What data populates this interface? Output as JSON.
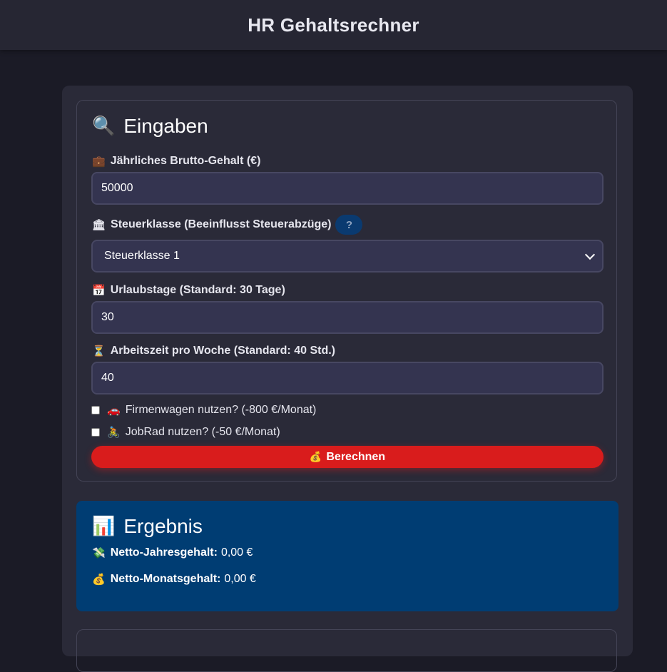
{
  "header": {
    "title": "HR Gehaltsrechner"
  },
  "inputs": {
    "title": "Eingaben",
    "title_icon": "magnifier-icon",
    "salary": {
      "label": "Jährliches Brutto-Gehalt (€)",
      "icon": "briefcase-icon",
      "value": "50000"
    },
    "tax_class": {
      "label": "Steuerklasse (Beeinflusst Steuerabzüge)",
      "icon": "bank-icon",
      "help": "?",
      "selected": "Steuerklasse 1"
    },
    "vacation": {
      "label": "Urlaubstage (Standard: 30 Tage)",
      "icon": "calendar-icon",
      "value": "30"
    },
    "hours": {
      "label": "Arbeitszeit pro Woche (Standard: 40 Std.)",
      "icon": "hourglass-icon",
      "value": "40"
    },
    "company_car": {
      "label": "Firmenwagen nutzen? (-800 €/Monat)",
      "icon": "car-icon",
      "checked": false
    },
    "job_bike": {
      "label": "JobRad nutzen? (-50 €/Monat)",
      "icon": "cyclist-icon",
      "checked": false
    },
    "calculate_label": "Berechnen",
    "calculate_icon": "money-bag-icon"
  },
  "result": {
    "title": "Ergebnis",
    "title_icon": "bar-chart-icon",
    "net_yearly": {
      "label": "Netto-Jahresgehalt:",
      "value": "0,00 €",
      "icon": "flying-money-icon"
    },
    "net_monthly": {
      "label": "Netto-Monatsgehalt:",
      "value": "0,00 €",
      "icon": "money-bag-icon"
    }
  },
  "colors": {
    "accent_red": "#d91c1c",
    "result_blue": "#003d73",
    "background": "#1b1b26",
    "card": "#2a2a38"
  }
}
